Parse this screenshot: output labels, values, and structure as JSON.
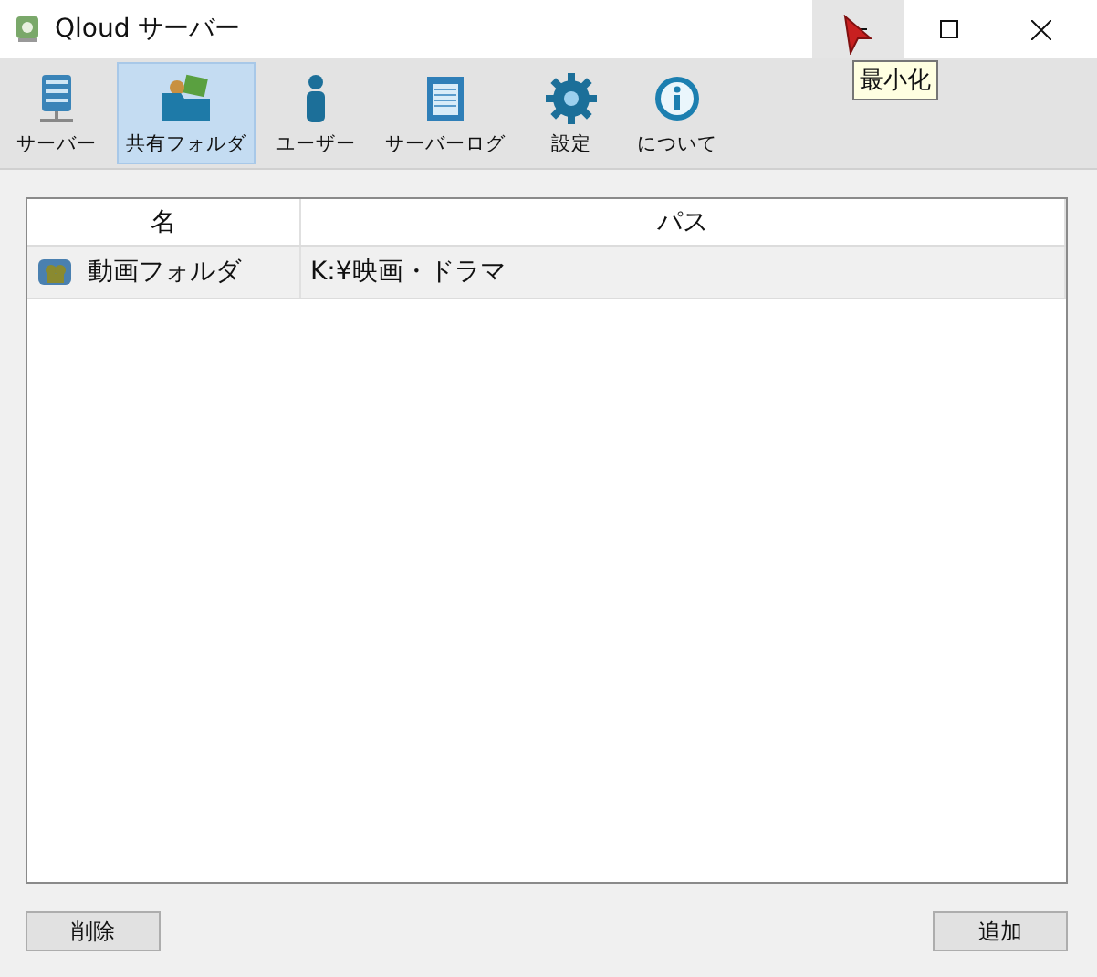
{
  "window": {
    "title": "Qloud サーバー",
    "controls": [
      {
        "kind": "minimize",
        "hovered": true
      },
      {
        "kind": "maximize",
        "hovered": false
      },
      {
        "kind": "close",
        "hovered": false
      }
    ],
    "tooltip": "最小化"
  },
  "toolbar": [
    {
      "kind": "server",
      "label": "サーバー",
      "selected": false
    },
    {
      "kind": "folder",
      "label": "共有フォルダ",
      "selected": true
    },
    {
      "kind": "user",
      "label": "ユーザー",
      "selected": false
    },
    {
      "kind": "log",
      "label": "サーバーログ",
      "selected": false
    },
    {
      "kind": "settings",
      "label": "設定",
      "selected": false
    },
    {
      "kind": "info",
      "label": "について",
      "selected": false
    }
  ],
  "table": {
    "columns": [
      "名",
      "パス"
    ],
    "rows": [
      {
        "name": "動画フォルダ",
        "path": "K:¥映画・ドラマ",
        "selected": true
      }
    ]
  },
  "buttons": [
    "削除",
    "追加"
  ]
}
